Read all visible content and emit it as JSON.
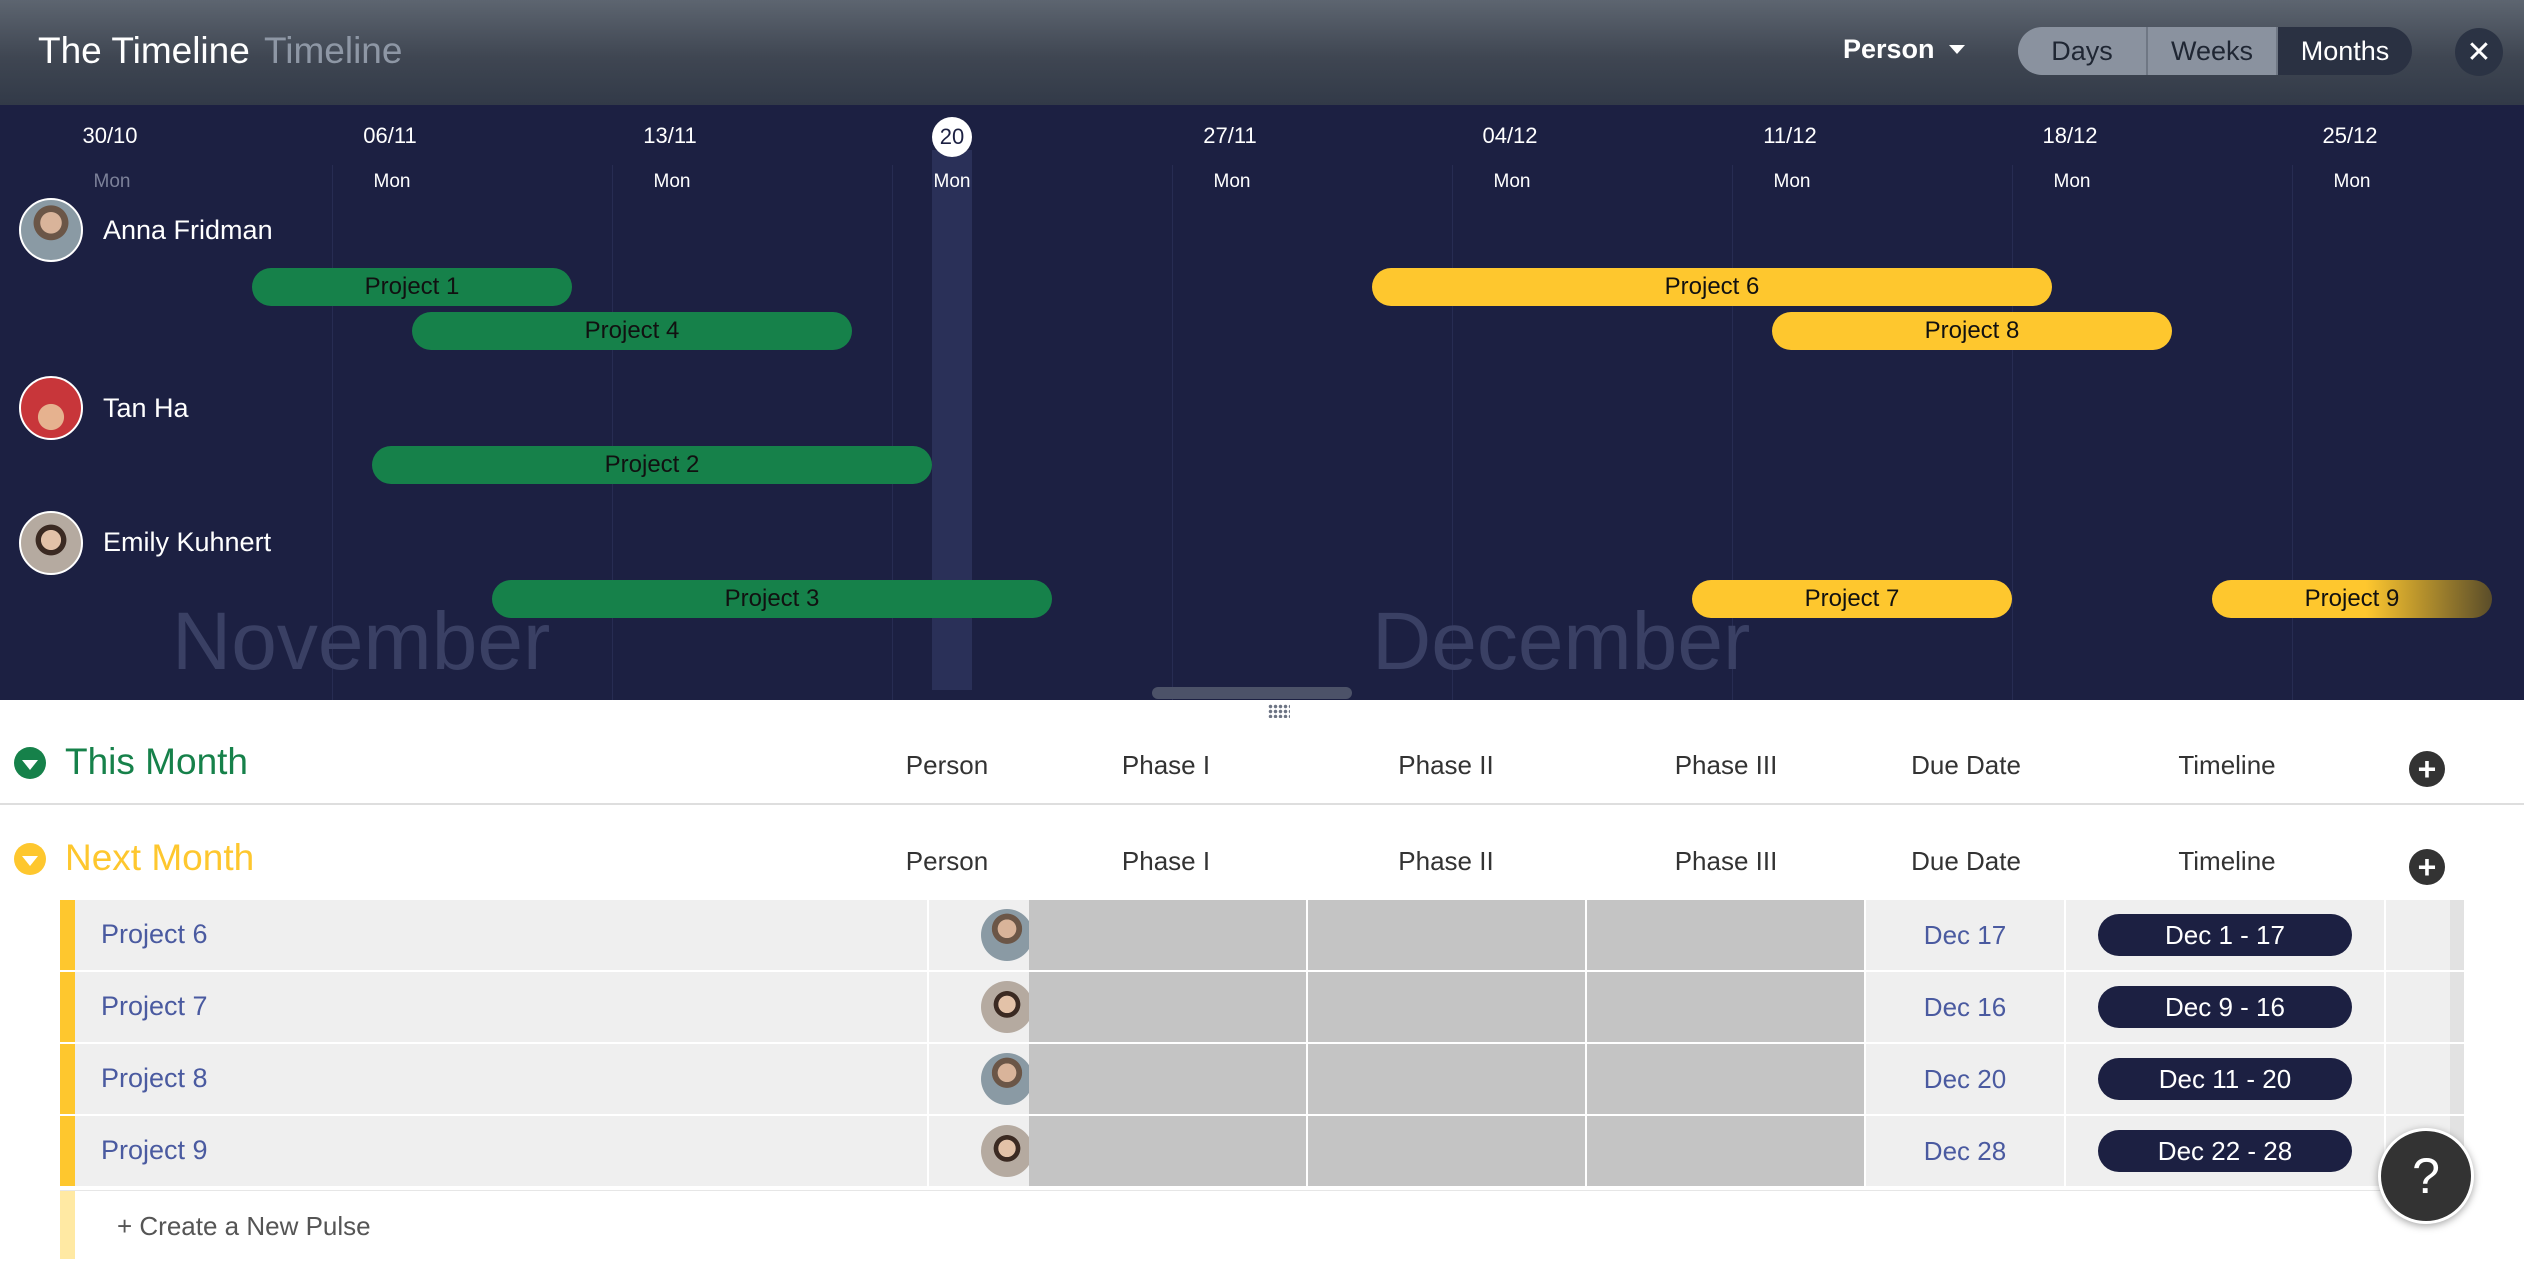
{
  "header": {
    "title": "The Timeline",
    "subtitle": "Timeline",
    "group_by": "Person",
    "views": [
      "Days",
      "Weeks",
      "Months"
    ],
    "active_view": "Months",
    "close_icon": "close-icon"
  },
  "timeline": {
    "columns": [
      {
        "date": "30/10",
        "dow": "Mon"
      },
      {
        "date": "06/11",
        "dow": "Mon"
      },
      {
        "date": "13/11",
        "dow": "Mon"
      },
      {
        "date": "20",
        "dow": "Mon"
      },
      {
        "date": "27/11",
        "dow": "Mon"
      },
      {
        "date": "04/12",
        "dow": "Mon"
      },
      {
        "date": "11/12",
        "dow": "Mon"
      },
      {
        "date": "18/12",
        "dow": "Mon"
      },
      {
        "date": "25/12",
        "dow": "Mon"
      }
    ],
    "months": [
      "November",
      "December"
    ],
    "people": [
      {
        "name": "Anna Fridman",
        "projects": [
          "Project 1",
          "Project 4",
          "Project 6",
          "Project 8"
        ]
      },
      {
        "name": "Tan Ha",
        "projects": [
          "Project 2"
        ]
      },
      {
        "name": "Emily Kuhnert",
        "projects": [
          "Project 3",
          "Project 7",
          "Project 9"
        ]
      }
    ],
    "colors": {
      "this_month": "#16814a",
      "next_month": "#fec72e",
      "background": "#1c2042"
    }
  },
  "board": {
    "columns": [
      "Person",
      "Phase I",
      "Phase II",
      "Phase III",
      "Due Date",
      "Timeline"
    ],
    "groups": [
      {
        "title": "This Month",
        "color": "#16814a",
        "rows": []
      },
      {
        "title": "Next Month",
        "color": "#fec72e",
        "rows": [
          {
            "name": "Project 6",
            "person": "Anna Fridman",
            "due": "Dec 17",
            "timeline": "Dec 1 - 17"
          },
          {
            "name": "Project 7",
            "person": "Emily Kuhnert",
            "due": "Dec 16",
            "timeline": "Dec 9 - 16"
          },
          {
            "name": "Project 8",
            "person": "Anna Fridman",
            "due": "Dec 20",
            "timeline": "Dec 11 - 20"
          },
          {
            "name": "Project 9",
            "person": "Emily Kuhnert",
            "due": "Dec 28",
            "timeline": "Dec 22 - 28"
          }
        ]
      }
    ],
    "create_label": "+ Create a New Pulse",
    "add_column_icon": "plus-circle-icon"
  },
  "help": {
    "label": "?"
  }
}
